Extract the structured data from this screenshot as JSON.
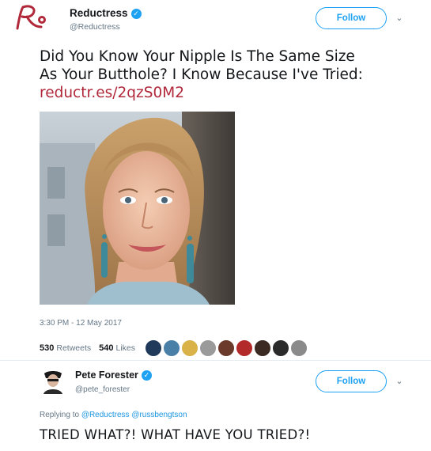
{
  "tweet": {
    "display_name": "Reductress",
    "handle": "@Reductress",
    "follow_label": "Follow",
    "text_line1": "Did You Know Your Nipple Is The Same Size",
    "text_line2": "As Your Butthole? I Know Because I've Tried:",
    "link": "reductr.es/2qzS0M2",
    "photo_icon": "woman-portrait-photo",
    "timestamp": "3:30 PM - 12 May 2017",
    "retweets_count": "530",
    "retweets_label": "Retweets",
    "likes_count": "540",
    "likes_label": "Likes"
  },
  "liker_avatars": [
    {
      "color": "#1f3a5a"
    },
    {
      "color": "#4a7fa8"
    },
    {
      "color": "#d9b24a"
    },
    {
      "color": "#9a9a9a"
    },
    {
      "color": "#6b3a2a"
    },
    {
      "color": "#b22a2a"
    },
    {
      "color": "#3a2a22"
    },
    {
      "color": "#2a2a2a"
    },
    {
      "color": "#8a8a8a"
    }
  ],
  "reply": {
    "display_name": "Pete Forester",
    "handle": "@pete_forester",
    "follow_label": "Follow",
    "replying_prefix": "Replying to",
    "mention1": "@Reductress",
    "mention2": "@russbengtson",
    "text": "TRIED WHAT?! WHAT HAVE YOU TRIED?!"
  },
  "colors": {
    "accent": "#1da1f2",
    "link": "#b0283a"
  }
}
